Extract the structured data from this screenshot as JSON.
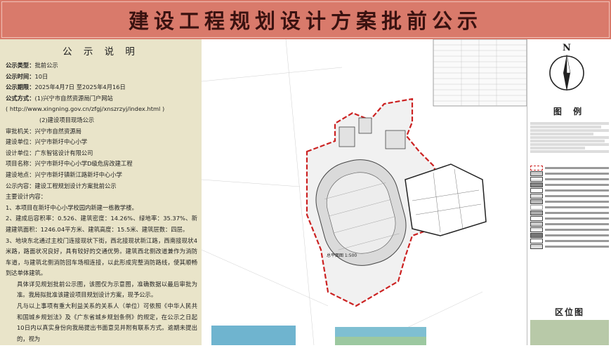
{
  "banner": {
    "title": "建设工程规划设计方案批前公示"
  },
  "notice": {
    "heading": "公 示 说 明",
    "type_label": "公示类型：",
    "type_value": "批前公示",
    "time_label": "公示时间：",
    "time_value": "10日",
    "period_label": "公示期限：",
    "period_value": "2025年4月7日 至2025年4月16日",
    "method_label": "公式方式：",
    "method_value": "(1)兴宁市自然资源局门户网站",
    "url": "( http://www.xingning.gov.cn/zfgj/xnszrzyj/index.html )",
    "method2": "(2)建设项目现场公示",
    "authority": "审批机关：兴宁市自然资源局",
    "builder": "建设单位：兴宁市新圩中心小学",
    "designer": "设计单位：广东智铭设计有限公司",
    "project": "项目名称：兴宁市新圩中心小学D级危房改建工程",
    "location": "建设地点：兴宁市新圩镇新江路新圩中心小学",
    "content": "公示内容：建设工程规划设计方案批前公示",
    "main_label": "主要设计内容：",
    "item1": "1、本项目在新圩中心小学校园内新建一栋教学楼。",
    "item2": "2、建成后容积率：0.526、建筑密度：14.26%、绿地率：35.37%、新建建筑面积：1246.04平方米、建筑高度：15.5米、建筑层数：四层。",
    "item3": "3、地块东北通过主校门连接现状下街，西北接现状新江路，西南接现状4米路，路面状况良好，具有较好的交通优势。建筑西北侧改道兼作为消防车道，与建筑北侧消防回车场相连接，以此形成完整消防路线，使其顺畅到达单体建筑。",
    "para1": "具体详见规划批前公示图，该图仅为示意图，准确数据以最后审批为准。我局拟批准该建设项目规划设计方案，现予公示。",
    "para2": "凡与以上事项有重大利益关系的关系人（单位）可依照《中华人民共和国城乡规划法》及《广东省城乡规划条例》的规定，在公示之日起10日内以真实身份向我局提出书面意见并附有联系方式。逾期未提出的，视为"
  },
  "plan": {
    "caption": "总平面图 1:500"
  },
  "right": {
    "north": "N",
    "legend_title": "图 例",
    "location_title": "区位图"
  }
}
